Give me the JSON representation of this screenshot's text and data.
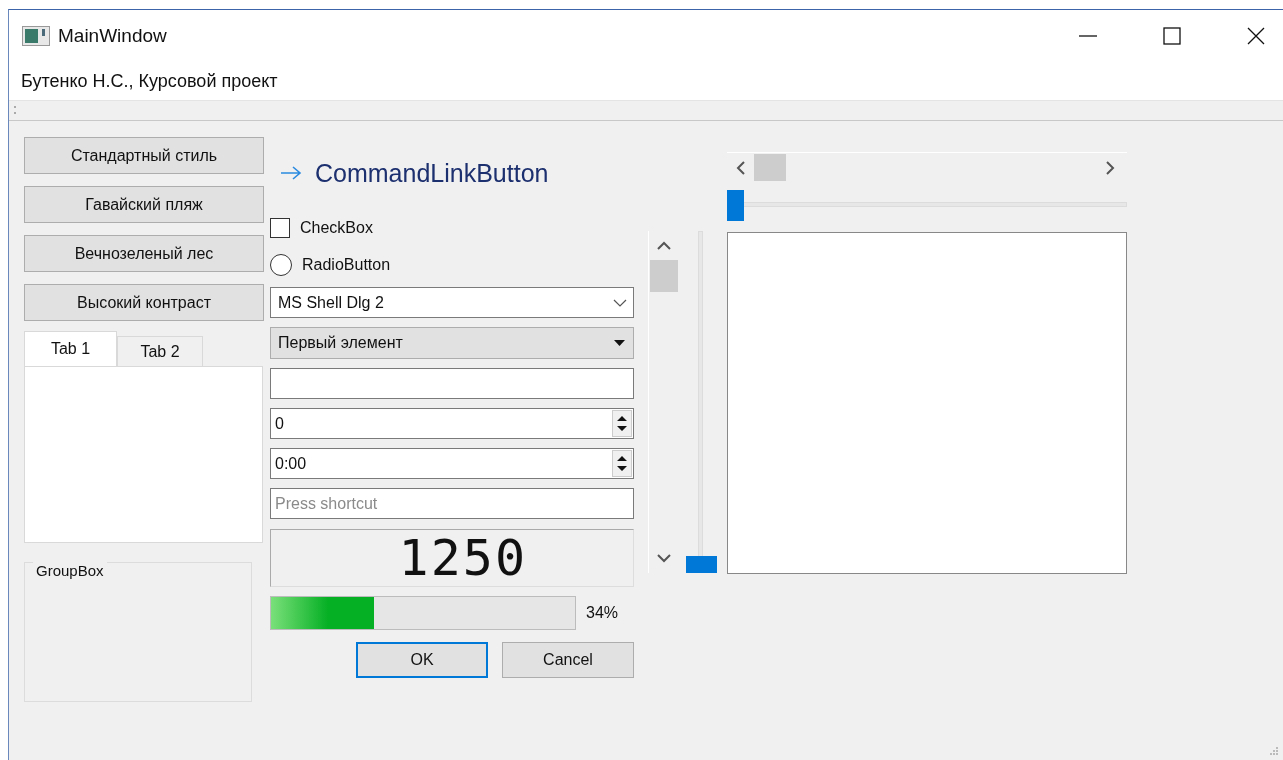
{
  "window": {
    "title": "MainWindow"
  },
  "menu_bar": {
    "label": "Бутенко Н.С., Курсовой проект"
  },
  "style_buttons": [
    {
      "label": "Стандартный стиль"
    },
    {
      "label": "Гавайский пляж"
    },
    {
      "label": "Вечнозеленый лес"
    },
    {
      "label": "Высокий контраст"
    }
  ],
  "tabs": [
    {
      "label": "Tab 1",
      "selected": true
    },
    {
      "label": "Tab 2",
      "selected": false
    }
  ],
  "group_box": {
    "title": "GroupBox"
  },
  "command_link": {
    "label": "CommandLinkButton"
  },
  "checkbox": {
    "label": "CheckBox",
    "checked": false
  },
  "radio": {
    "label": "RadioButton",
    "selected": false
  },
  "font_combo": {
    "value": "MS Shell Dlg 2"
  },
  "combo": {
    "value": "Первый элемент"
  },
  "spin_box": {
    "value": "0"
  },
  "time_edit": {
    "value": "0:00"
  },
  "key_sequence": {
    "placeholder": "Press shortcut"
  },
  "lcd": {
    "value": "1250"
  },
  "progress": {
    "level": 0.34,
    "reading": "34%"
  },
  "buttons": [
    {
      "label": "OK",
      "default": true
    },
    {
      "label": "Cancel",
      "default": false
    }
  ],
  "vertical_slider": {
    "level": 0
  },
  "horizontal_slider": {
    "level": 0
  }
}
